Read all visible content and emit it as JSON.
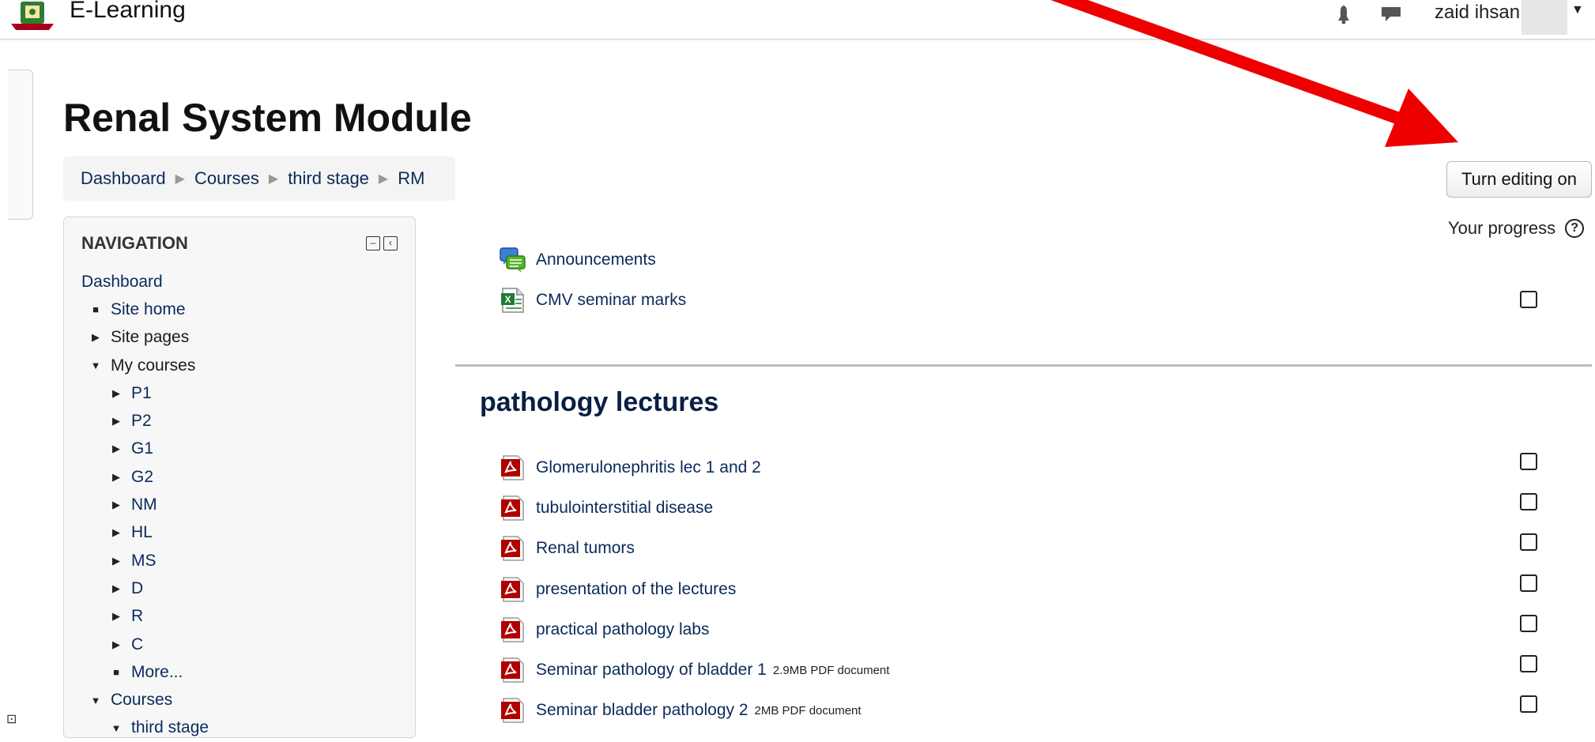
{
  "site": {
    "name": "E-Learning"
  },
  "user": {
    "name": "zaid ihsan"
  },
  "page": {
    "title": "Renal System Module"
  },
  "breadcrumb": [
    {
      "label": "Dashboard"
    },
    {
      "label": "Courses"
    },
    {
      "label": "third stage"
    },
    {
      "label": "RM"
    }
  ],
  "buttons": {
    "edit": "Turn editing on"
  },
  "progress": {
    "label": "Your progress"
  },
  "navigation": {
    "title": "NAVIGATION",
    "items": [
      {
        "label": "Dashboard",
        "type": "link"
      },
      {
        "label": "Site home",
        "type": "bullet"
      },
      {
        "label": "Site pages",
        "type": "collapsed"
      },
      {
        "label": "My courses",
        "type": "expanded"
      },
      {
        "label": "P1",
        "type": "collapsed"
      },
      {
        "label": "P2",
        "type": "collapsed"
      },
      {
        "label": "G1",
        "type": "collapsed"
      },
      {
        "label": "G2",
        "type": "collapsed"
      },
      {
        "label": "NM",
        "type": "collapsed"
      },
      {
        "label": "HL",
        "type": "collapsed"
      },
      {
        "label": "MS",
        "type": "collapsed"
      },
      {
        "label": "D",
        "type": "collapsed"
      },
      {
        "label": "R",
        "type": "collapsed"
      },
      {
        "label": "C",
        "type": "collapsed"
      },
      {
        "label": "More...",
        "type": "bullet"
      },
      {
        "label": "Courses",
        "type": "expanded"
      },
      {
        "label": "third stage",
        "type": "expanded"
      }
    ]
  },
  "general_activities": [
    {
      "label": "Announcements",
      "icon": "forum-icon"
    },
    {
      "label": "CMV seminar marks",
      "icon": "spreadsheet-icon"
    }
  ],
  "section": {
    "title": "pathology lectures",
    "activities": [
      {
        "label": "Glomerulonephritis lec 1 and 2",
        "meta": "",
        "icon": "pdf-icon"
      },
      {
        "label": "tubulointerstitial disease",
        "meta": "",
        "icon": "pdf-icon"
      },
      {
        "label": "Renal tumors",
        "meta": "",
        "icon": "pdf-icon"
      },
      {
        "label": "presentation of the lectures",
        "meta": "",
        "icon": "pdf-icon"
      },
      {
        "label": "practical pathology labs",
        "meta": "",
        "icon": "pdf-icon"
      },
      {
        "label": "Seminar pathology of bladder 1",
        "meta": "2.9MB PDF document",
        "icon": "pdf-icon"
      },
      {
        "label": "Seminar bladder pathology 2",
        "meta": "2MB PDF document",
        "icon": "pdf-icon"
      }
    ]
  },
  "colors": {
    "link": "#0a2a5b",
    "annotation_arrow": "#ee0000",
    "pdf_icon": "#b00000"
  }
}
